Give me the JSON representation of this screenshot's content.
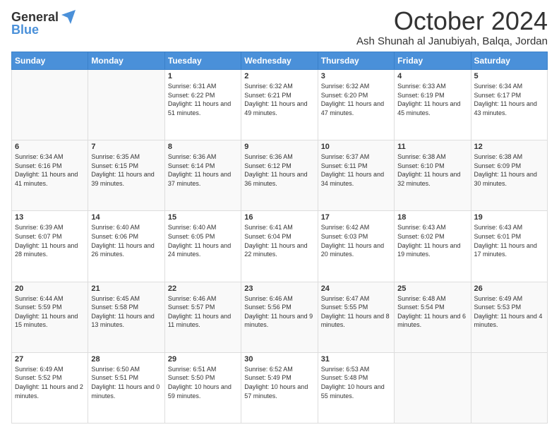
{
  "logo": {
    "general": "General",
    "blue": "Blue"
  },
  "header": {
    "month": "October 2024",
    "location": "Ash Shunah al Janubiyah, Balqa, Jordan"
  },
  "weekdays": [
    "Sunday",
    "Monday",
    "Tuesday",
    "Wednesday",
    "Thursday",
    "Friday",
    "Saturday"
  ],
  "weeks": [
    [
      {
        "day": null
      },
      {
        "day": null
      },
      {
        "day": "1",
        "sunrise": "6:31 AM",
        "sunset": "6:22 PM",
        "daylight": "11 hours and 51 minutes."
      },
      {
        "day": "2",
        "sunrise": "6:32 AM",
        "sunset": "6:21 PM",
        "daylight": "11 hours and 49 minutes."
      },
      {
        "day": "3",
        "sunrise": "6:32 AM",
        "sunset": "6:20 PM",
        "daylight": "11 hours and 47 minutes."
      },
      {
        "day": "4",
        "sunrise": "6:33 AM",
        "sunset": "6:19 PM",
        "daylight": "11 hours and 45 minutes."
      },
      {
        "day": "5",
        "sunrise": "6:34 AM",
        "sunset": "6:17 PM",
        "daylight": "11 hours and 43 minutes."
      }
    ],
    [
      {
        "day": "6",
        "sunrise": "6:34 AM",
        "sunset": "6:16 PM",
        "daylight": "11 hours and 41 minutes."
      },
      {
        "day": "7",
        "sunrise": "6:35 AM",
        "sunset": "6:15 PM",
        "daylight": "11 hours and 39 minutes."
      },
      {
        "day": "8",
        "sunrise": "6:36 AM",
        "sunset": "6:14 PM",
        "daylight": "11 hours and 37 minutes."
      },
      {
        "day": "9",
        "sunrise": "6:36 AM",
        "sunset": "6:12 PM",
        "daylight": "11 hours and 36 minutes."
      },
      {
        "day": "10",
        "sunrise": "6:37 AM",
        "sunset": "6:11 PM",
        "daylight": "11 hours and 34 minutes."
      },
      {
        "day": "11",
        "sunrise": "6:38 AM",
        "sunset": "6:10 PM",
        "daylight": "11 hours and 32 minutes."
      },
      {
        "day": "12",
        "sunrise": "6:38 AM",
        "sunset": "6:09 PM",
        "daylight": "11 hours and 30 minutes."
      }
    ],
    [
      {
        "day": "13",
        "sunrise": "6:39 AM",
        "sunset": "6:07 PM",
        "daylight": "11 hours and 28 minutes."
      },
      {
        "day": "14",
        "sunrise": "6:40 AM",
        "sunset": "6:06 PM",
        "daylight": "11 hours and 26 minutes."
      },
      {
        "day": "15",
        "sunrise": "6:40 AM",
        "sunset": "6:05 PM",
        "daylight": "11 hours and 24 minutes."
      },
      {
        "day": "16",
        "sunrise": "6:41 AM",
        "sunset": "6:04 PM",
        "daylight": "11 hours and 22 minutes."
      },
      {
        "day": "17",
        "sunrise": "6:42 AM",
        "sunset": "6:03 PM",
        "daylight": "11 hours and 20 minutes."
      },
      {
        "day": "18",
        "sunrise": "6:43 AM",
        "sunset": "6:02 PM",
        "daylight": "11 hours and 19 minutes."
      },
      {
        "day": "19",
        "sunrise": "6:43 AM",
        "sunset": "6:01 PM",
        "daylight": "11 hours and 17 minutes."
      }
    ],
    [
      {
        "day": "20",
        "sunrise": "6:44 AM",
        "sunset": "5:59 PM",
        "daylight": "11 hours and 15 minutes."
      },
      {
        "day": "21",
        "sunrise": "6:45 AM",
        "sunset": "5:58 PM",
        "daylight": "11 hours and 13 minutes."
      },
      {
        "day": "22",
        "sunrise": "6:46 AM",
        "sunset": "5:57 PM",
        "daylight": "11 hours and 11 minutes."
      },
      {
        "day": "23",
        "sunrise": "6:46 AM",
        "sunset": "5:56 PM",
        "daylight": "11 hours and 9 minutes."
      },
      {
        "day": "24",
        "sunrise": "6:47 AM",
        "sunset": "5:55 PM",
        "daylight": "11 hours and 8 minutes."
      },
      {
        "day": "25",
        "sunrise": "6:48 AM",
        "sunset": "5:54 PM",
        "daylight": "11 hours and 6 minutes."
      },
      {
        "day": "26",
        "sunrise": "6:49 AM",
        "sunset": "5:53 PM",
        "daylight": "11 hours and 4 minutes."
      }
    ],
    [
      {
        "day": "27",
        "sunrise": "6:49 AM",
        "sunset": "5:52 PM",
        "daylight": "11 hours and 2 minutes."
      },
      {
        "day": "28",
        "sunrise": "6:50 AM",
        "sunset": "5:51 PM",
        "daylight": "11 hours and 0 minutes."
      },
      {
        "day": "29",
        "sunrise": "6:51 AM",
        "sunset": "5:50 PM",
        "daylight": "10 hours and 59 minutes."
      },
      {
        "day": "30",
        "sunrise": "6:52 AM",
        "sunset": "5:49 PM",
        "daylight": "10 hours and 57 minutes."
      },
      {
        "day": "31",
        "sunrise": "6:53 AM",
        "sunset": "5:48 PM",
        "daylight": "10 hours and 55 minutes."
      },
      {
        "day": null
      },
      {
        "day": null
      }
    ]
  ],
  "labels": {
    "sunrise": "Sunrise:",
    "sunset": "Sunset:",
    "daylight": "Daylight:"
  }
}
